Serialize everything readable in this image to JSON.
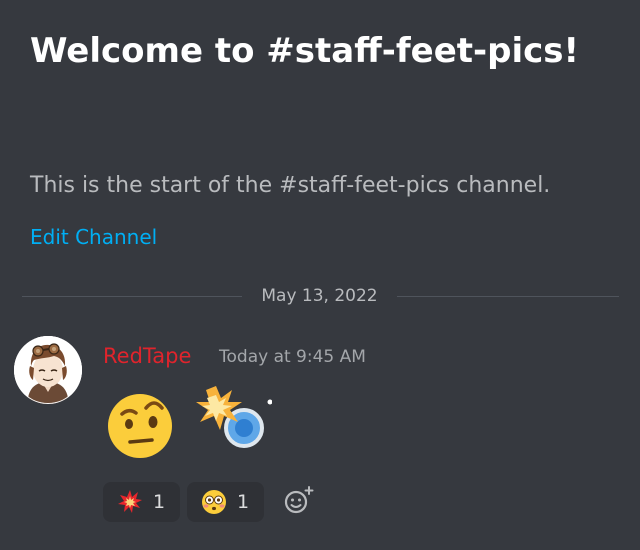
{
  "welcome": {
    "title": "Welcome to #staff-feet-pics!",
    "subtitle": "This is the start of the #staff-feet-pics channel.",
    "edit_link": "Edit Channel"
  },
  "divider": {
    "date": "May 13, 2022"
  },
  "message": {
    "author": "RedTape",
    "author_color": "#e0242c",
    "timestamp": "Today at 9:45 AM",
    "content_emojis": [
      "face-with-raised-eyebrow-icon",
      "collision-icon"
    ]
  },
  "reactions": [
    {
      "emoji": "collision-icon",
      "count": "1"
    },
    {
      "emoji": "flushed-face-icon",
      "count": "1"
    }
  ],
  "add_reaction_icon": "add-reaction-icon",
  "colors": {
    "background": "#36393f",
    "link": "#00aff4",
    "reaction_bg": "#2f3136"
  }
}
